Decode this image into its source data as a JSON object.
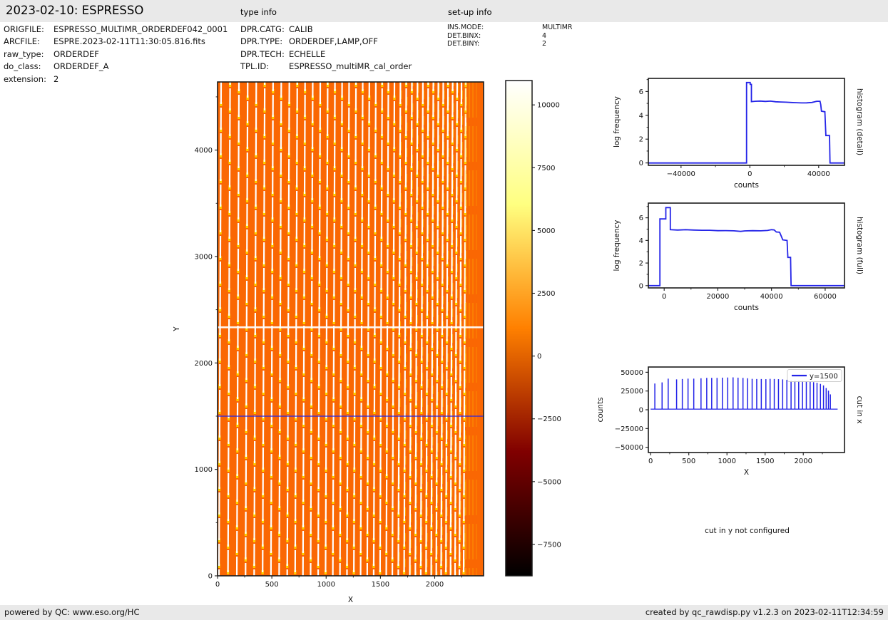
{
  "header": {
    "title": "2023-02-10: ESPRESSO",
    "type_info": "type info",
    "setup_info": "set-up info"
  },
  "file_info": [
    {
      "label": "ORIGFILE:",
      "value": "ESPRESSO_MULTIMR_ORDERDEF042_0001"
    },
    {
      "label": "ARCFILE:",
      "value": "ESPRE.2023-02-11T11:30:05.816.fits"
    },
    {
      "label": "raw_type:",
      "value": "ORDERDEF"
    },
    {
      "label": "do_class:",
      "value": "ORDERDEF_A"
    },
    {
      "label": "extension:",
      "value": "2"
    }
  ],
  "type_info": [
    {
      "label": "DPR.CATG:",
      "value": "CALIB"
    },
    {
      "label": "DPR.TYPE:",
      "value": "ORDERDEF,LAMP,OFF"
    },
    {
      "label": "DPR.TECH:",
      "value": "ECHELLE"
    },
    {
      "label": "TPL.ID:",
      "value": "ESPRESSO_multiMR_cal_order"
    }
  ],
  "setup_info": [
    {
      "label": "INS.MODE:",
      "value": "MULTIMR"
    },
    {
      "label": "DET.BINX:",
      "value": "4"
    },
    {
      "label": "DET.BINY:",
      "value": "2"
    }
  ],
  "note": "cut in y not configured",
  "footer": {
    "left": "powered by QC: www.eso.org/HC",
    "right": "created by qc_rawdisp.py v1.2.3 on 2023-02-11T12:34:59"
  },
  "colors": {
    "header_bg": "#e9e9e9",
    "heatmap_base": "#fa6703",
    "stripe": "#ffffff",
    "stripe_tip": "#ffd400",
    "line_blue": "#2424e8",
    "axis": "#1a1a1a"
  },
  "chart_data": [
    {
      "id": "raw_display",
      "type": "heatmap",
      "xlabel": "X",
      "ylabel": "Y",
      "xlim": [
        0,
        2450
      ],
      "ylim": [
        0,
        4640
      ],
      "xticks": [
        0,
        500,
        1000,
        1500,
        2000
      ],
      "xminor": [
        250,
        750,
        1250,
        1750,
        2250
      ],
      "yticks": [
        0,
        1000,
        2000,
        3000,
        4000
      ],
      "yminor": [
        500,
        1500,
        2500,
        3500,
        4500
      ],
      "colormap": "afmhot",
      "order_stripes": {
        "count": 38,
        "note": "vertical echelle order traces, white with yellow tips, spacing narrows toward the right, faint yellow streaks at far right"
      },
      "detector_gap_y": 2335,
      "cut_line": {
        "y": 1500,
        "color": "#2424e8"
      }
    },
    {
      "id": "colorbar",
      "type": "colorbar",
      "colormap": "afmhot",
      "vmin": -8750,
      "vmax": 10970,
      "ticks": [
        10000,
        7500,
        5000,
        2500,
        0,
        -2500,
        -5000,
        -7500
      ]
    },
    {
      "id": "histogram_detail",
      "type": "line",
      "right_title": "histogram (detail)",
      "xlabel": "counts",
      "ylabel": "log frequency",
      "xlim": [
        -59000,
        55000
      ],
      "ylim": [
        -0.2,
        7.1
      ],
      "xticks": [
        -40000,
        0,
        40000
      ],
      "xminor": [
        -20000,
        20000
      ],
      "yticks": [
        0,
        2,
        4,
        6
      ],
      "yminor": [
        1,
        3,
        5,
        7
      ],
      "line_color": "#2424e8",
      "points": [
        [
          -59000,
          0
        ],
        [
          -1900,
          0
        ],
        [
          -1900,
          6.75
        ],
        [
          200,
          6.75
        ],
        [
          200,
          6.6
        ],
        [
          900,
          6.6
        ],
        [
          900,
          5.15
        ],
        [
          3000,
          5.18
        ],
        [
          6000,
          5.2
        ],
        [
          9000,
          5.17
        ],
        [
          12000,
          5.19
        ],
        [
          15000,
          5.14
        ],
        [
          18000,
          5.12
        ],
        [
          21000,
          5.1
        ],
        [
          24000,
          5.08
        ],
        [
          27000,
          5.06
        ],
        [
          30000,
          5.04
        ],
        [
          33000,
          5.05
        ],
        [
          36000,
          5.08
        ],
        [
          38000,
          5.15
        ],
        [
          39000,
          5.18
        ],
        [
          40800,
          5.18
        ],
        [
          41200,
          4.9
        ],
        [
          41600,
          4.35
        ],
        [
          43600,
          4.3
        ],
        [
          44200,
          2.3
        ],
        [
          46300,
          2.3
        ],
        [
          46600,
          0
        ],
        [
          55000,
          0
        ]
      ]
    },
    {
      "id": "histogram_full",
      "type": "line",
      "right_title": "histogram (full)",
      "xlabel": "counts",
      "ylabel": "log frequency",
      "xlim": [
        -5900,
        67200
      ],
      "ylim": [
        -0.2,
        7.3
      ],
      "xticks": [
        0,
        20000,
        40000,
        60000
      ],
      "xminor": [
        10000,
        30000,
        50000
      ],
      "yticks": [
        0,
        2,
        4,
        6
      ],
      "yminor": [
        1,
        3,
        5,
        7
      ],
      "line_color": "#2424e8",
      "points": [
        [
          -5900,
          0
        ],
        [
          -1600,
          0
        ],
        [
          -1600,
          5.9
        ],
        [
          600,
          5.9
        ],
        [
          600,
          6.9
        ],
        [
          2300,
          6.9
        ],
        [
          2300,
          4.95
        ],
        [
          5000,
          4.92
        ],
        [
          8000,
          4.95
        ],
        [
          11000,
          4.92
        ],
        [
          14000,
          4.9
        ],
        [
          17000,
          4.9
        ],
        [
          20000,
          4.86
        ],
        [
          23000,
          4.87
        ],
        [
          26000,
          4.85
        ],
        [
          28500,
          4.8
        ],
        [
          30000,
          4.84
        ],
        [
          33000,
          4.86
        ],
        [
          36000,
          4.85
        ],
        [
          38500,
          4.88
        ],
        [
          40000,
          4.95
        ],
        [
          41000,
          4.93
        ],
        [
          41800,
          4.75
        ],
        [
          43000,
          4.72
        ],
        [
          43600,
          4.4
        ],
        [
          44200,
          4.05
        ],
        [
          45800,
          4.0
        ],
        [
          46100,
          2.5
        ],
        [
          47100,
          2.5
        ],
        [
          47300,
          0
        ],
        [
          67200,
          0
        ]
      ]
    },
    {
      "id": "cut_in_x",
      "type": "spikes",
      "right_title": "cut in x",
      "xlabel": "X",
      "ylabel": "counts",
      "legend": "y=1500",
      "xlim": [
        -30,
        2540
      ],
      "ylim": [
        -57000,
        57000
      ],
      "xticks": [
        0,
        500,
        1000,
        1500,
        2000
      ],
      "xminor": [
        250,
        750,
        1250,
        1750,
        2250
      ],
      "yticks": [
        50000,
        25000,
        0,
        -25000,
        -50000
      ],
      "yminor": [],
      "line_color": "#2424e8",
      "baseline": 800,
      "spikes": [
        [
          55,
          35000
        ],
        [
          150,
          36500
        ],
        [
          230,
          41500
        ],
        [
          340,
          40500
        ],
        [
          415,
          41000
        ],
        [
          490,
          41500
        ],
        [
          565,
          41500
        ],
        [
          660,
          42000
        ],
        [
          735,
          42500
        ],
        [
          800,
          42500
        ],
        [
          870,
          42500
        ],
        [
          940,
          42800
        ],
        [
          1010,
          43000
        ],
        [
          1080,
          43200
        ],
        [
          1145,
          42800
        ],
        [
          1210,
          42500
        ],
        [
          1270,
          42000
        ],
        [
          1330,
          41200
        ],
        [
          1390,
          41000
        ],
        [
          1450,
          41000
        ],
        [
          1510,
          40800
        ],
        [
          1565,
          41200
        ],
        [
          1620,
          41000
        ],
        [
          1675,
          40800
        ],
        [
          1730,
          40500
        ],
        [
          1785,
          40000
        ],
        [
          1840,
          39500
        ],
        [
          1890,
          39200
        ],
        [
          1940,
          39500
        ],
        [
          1990,
          38800
        ],
        [
          2040,
          38200
        ],
        [
          2090,
          37500
        ],
        [
          2135,
          36800
        ],
        [
          2180,
          36000
        ],
        [
          2225,
          34500
        ],
        [
          2265,
          32500
        ],
        [
          2300,
          29000
        ],
        [
          2330,
          25500
        ],
        [
          2355,
          20500
        ]
      ]
    }
  ]
}
